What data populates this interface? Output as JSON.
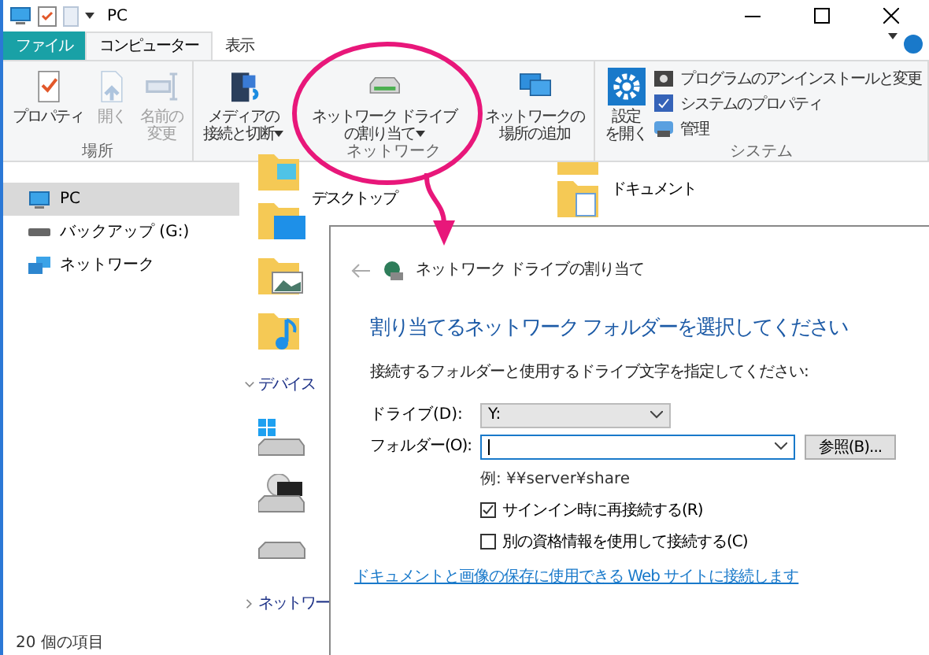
{
  "window": {
    "title": "PC"
  },
  "ribbon_tabs": [
    {
      "label": "ファイル",
      "kind": "file",
      "selected": false
    },
    {
      "label": "コンピューター",
      "kind": "tab",
      "selected": true
    },
    {
      "label": "表示",
      "kind": "tab",
      "selected": false
    }
  ],
  "ribbon_groups": [
    {
      "label": "場所",
      "buttons": [
        {
          "lines": [
            "プロパティ"
          ],
          "kind": "properties",
          "disabled": false,
          "dropdown": false
        },
        {
          "lines": [
            "開く"
          ],
          "kind": "open",
          "disabled": true,
          "dropdown": false
        },
        {
          "lines": [
            "名前の",
            "変更"
          ],
          "kind": "rename",
          "disabled": true,
          "dropdown": false
        }
      ]
    },
    {
      "label": "ネットワーク",
      "buttons": [
        {
          "lines": [
            "メディアの",
            "接続と切断"
          ],
          "kind": "media",
          "disabled": false,
          "dropdown": true
        },
        {
          "lines": [
            "ネットワーク ドライブ",
            "の割り当て"
          ],
          "kind": "netdrive",
          "disabled": false,
          "dropdown": true
        },
        {
          "lines": [
            "ネットワークの",
            "場所の追加"
          ],
          "kind": "netplace",
          "disabled": false,
          "dropdown": false
        }
      ]
    },
    {
      "label": "システム",
      "big": {
        "lines": [
          "設定",
          "を開く"
        ]
      },
      "items": [
        {
          "label": "プログラムのアンインストールと変更",
          "kind": "uninstall"
        },
        {
          "label": "システムのプロパティ",
          "kind": "sysprops"
        },
        {
          "label": "管理",
          "kind": "manage"
        }
      ]
    }
  ],
  "nav_items": [
    {
      "label": "PC",
      "kind": "pc",
      "selected": true
    },
    {
      "label": "バックアップ (G:)",
      "kind": "drive",
      "selected": false
    },
    {
      "label": "ネットワーク",
      "kind": "network",
      "selected": false
    }
  ],
  "content": {
    "left": [
      {
        "kind": "folder"
      },
      {
        "kind": "desktop",
        "label": "デスクトップ"
      },
      {
        "kind": "pictures"
      },
      {
        "kind": "music"
      },
      {
        "kind": "section",
        "label": "デバイス",
        "expanded": true
      },
      {
        "kind": "windrive"
      },
      {
        "kind": "bd"
      },
      {
        "kind": "drive"
      },
      {
        "kind": "section",
        "label": "ネットワー",
        "expanded": false
      }
    ],
    "right": [
      {
        "kind": "downloads"
      },
      {
        "kind": "documents",
        "label": "ドキュメント"
      }
    ]
  },
  "status_bar": "20 個の項目",
  "dialog": {
    "title": "ネットワーク ドライブの割り当て",
    "heading": "割り当てるネットワーク フォルダーを選択してください",
    "instruction": "接続するフォルダーと使用するドライブ文字を指定してください:",
    "drive_label": "ドライブ(D):",
    "drive_value": "Y:",
    "folder_label": "フォルダー(O):",
    "browse_button": "参照(B)...",
    "example": "例: ¥¥server¥share",
    "checkboxes": [
      {
        "label": "サインイン時に再接続する(R)",
        "checked": true
      },
      {
        "label": "別の資格情報を使用して接続する(C)",
        "checked": false
      }
    ],
    "link": "ドキュメントと画像の保存に使用できる Web サイトに接続します"
  }
}
